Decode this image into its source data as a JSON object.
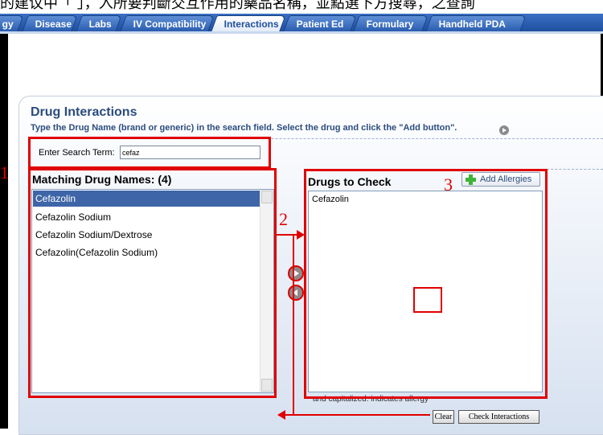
{
  "header_text": "的建议中「         」，入所要判斷交互作用的藥品名稱，並點選下方搜尋，之查詢",
  "tabs": [
    {
      "label": "gy"
    },
    {
      "label": "Disease"
    },
    {
      "label": "Labs"
    },
    {
      "label": "IV Compatibility"
    },
    {
      "label": "Interactions"
    },
    {
      "label": "Patient Ed"
    },
    {
      "label": "Formulary"
    },
    {
      "label": "Handheld PDA"
    }
  ],
  "panel": {
    "title": "Drug Interactions",
    "instructions": "Type the Drug Name (brand or generic) in the search field. Select the drug and click the \"Add button\"."
  },
  "search": {
    "label": "Enter Search Term:",
    "value": "cefaz"
  },
  "matching": {
    "heading": "Matching Drug Names: (4)",
    "items": [
      "Cefazolin",
      "Cefazolin Sodium",
      "Cefazolin Sodium/Dextrose",
      "Cefazolin(Cefazolin Sodium)"
    ]
  },
  "check": {
    "heading": "Drugs to Check",
    "add_allergies_label": "Add Allergies",
    "items": [
      "Cefazolin"
    ]
  },
  "note": "and capitalized: indicates allergy",
  "buttons": {
    "clear": "Clear",
    "check_interactions": "Check Interactions"
  },
  "annotations": {
    "n1": "1",
    "n2": "2",
    "n3": "3"
  },
  "colors": {
    "annotation": "#e00000",
    "tab_bar": "#1f4f9e",
    "selected_row": "#3e65a8",
    "heading": "#2b4c7e",
    "plus": "#3fb338"
  }
}
